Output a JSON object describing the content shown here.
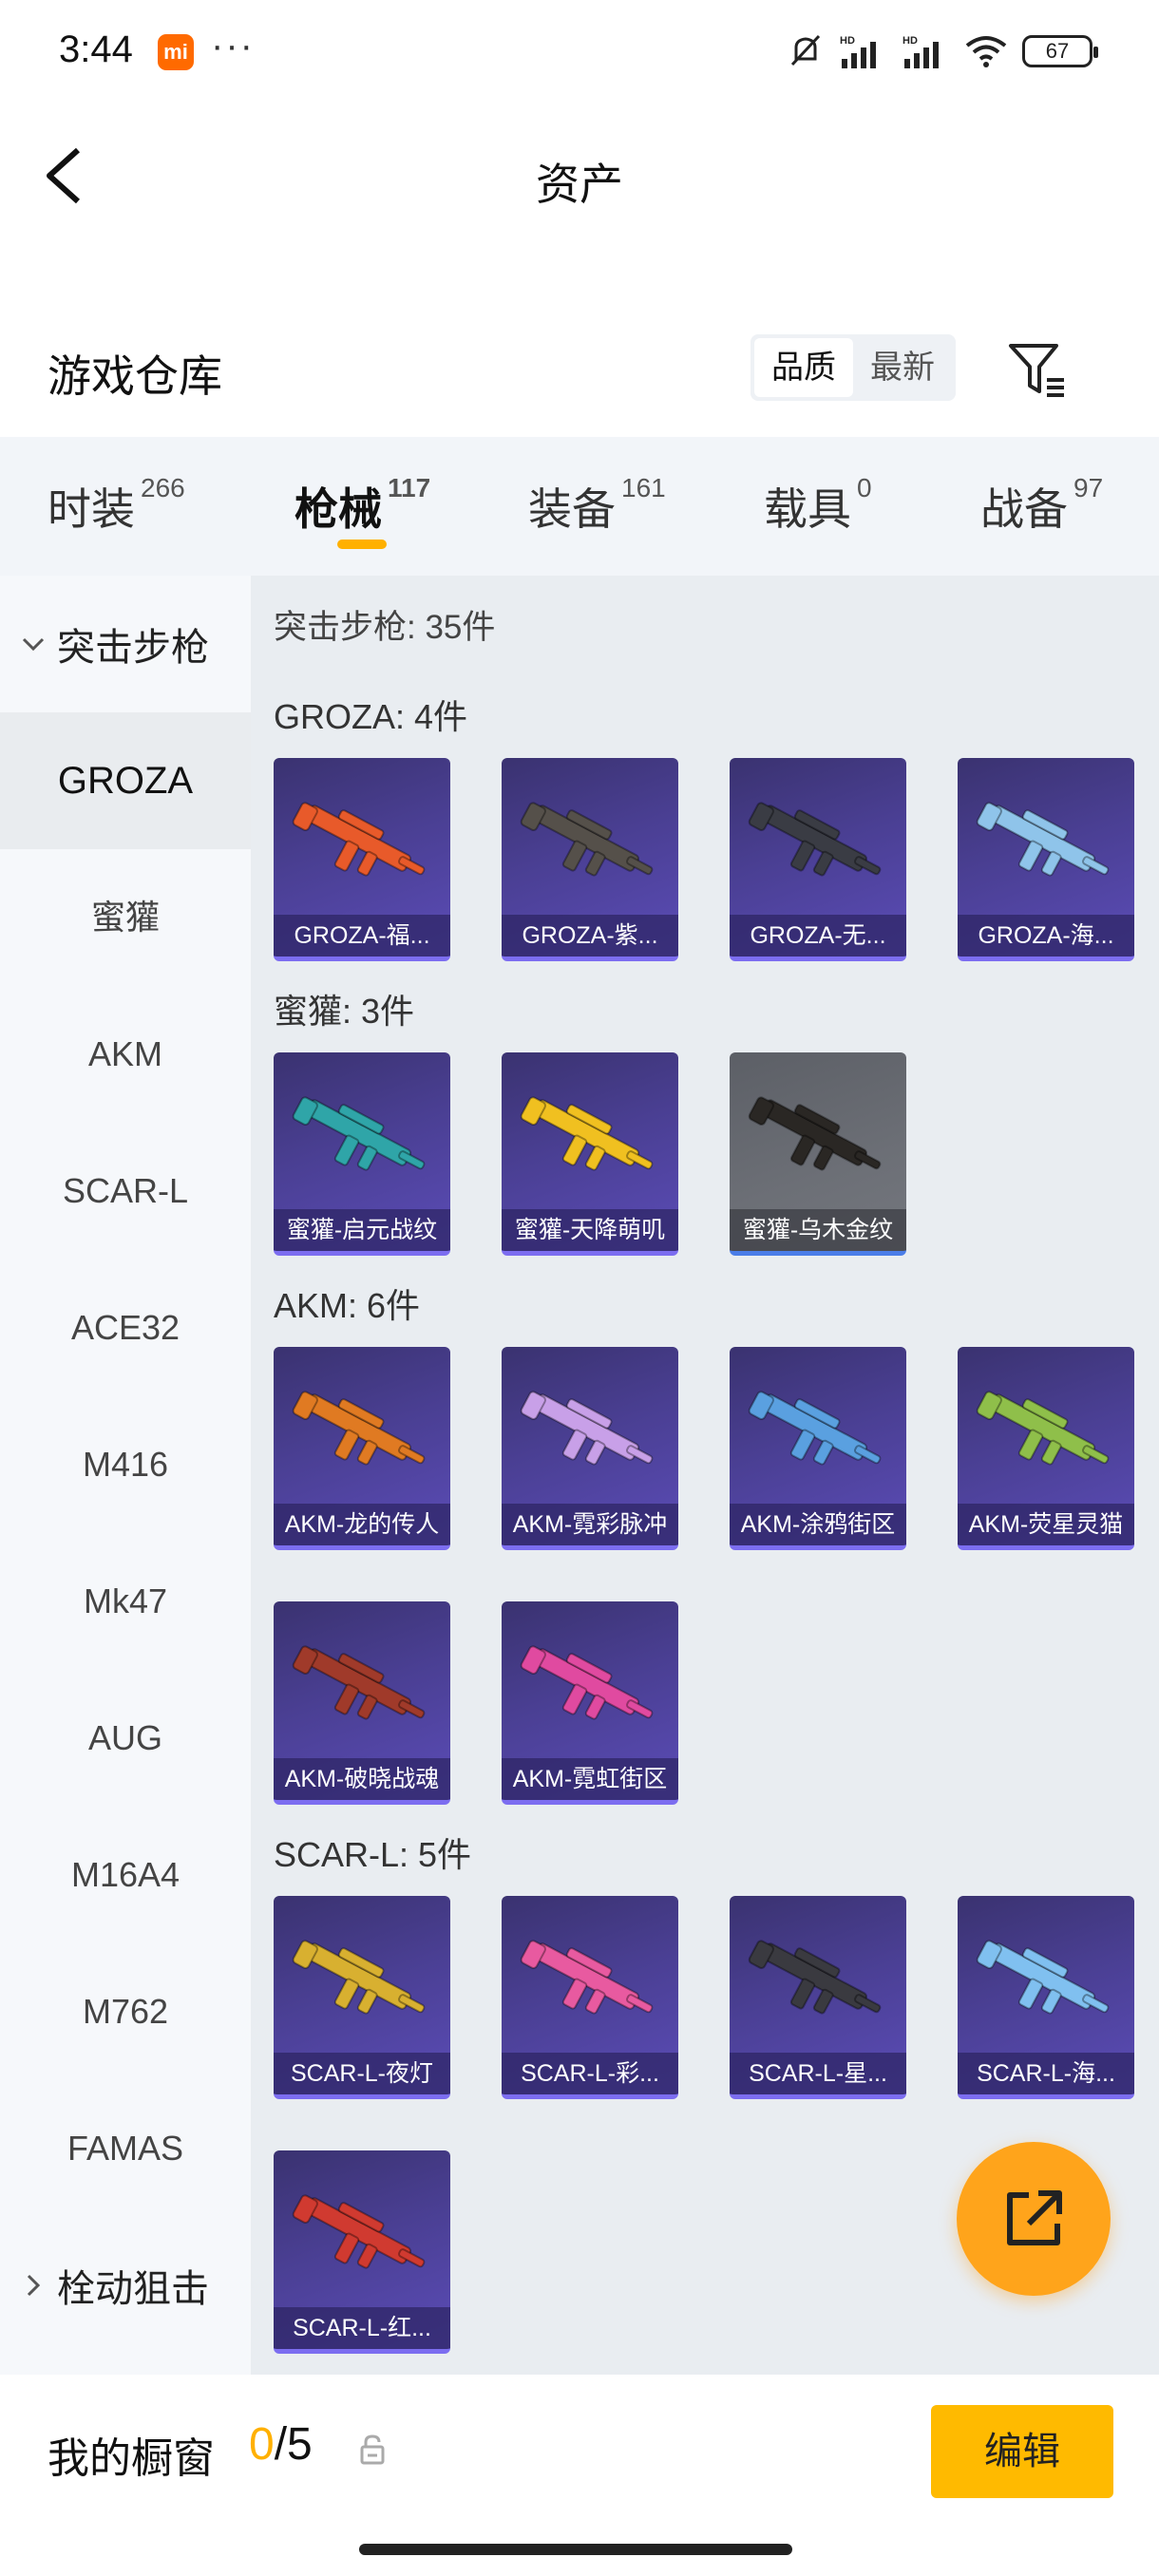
{
  "status_bar": {
    "time": "3:44",
    "mi": "mi",
    "dots": "···",
    "battery": "67"
  },
  "header": {
    "title": "资产"
  },
  "warehouse": {
    "title": "游戏仓库",
    "sort_quality": "品质",
    "sort_newest": "最新"
  },
  "tabs": [
    {
      "label": "时装",
      "count": "266"
    },
    {
      "label": "枪械",
      "count": "117"
    },
    {
      "label": "装备",
      "count": "161"
    },
    {
      "label": "载具",
      "count": "0"
    },
    {
      "label": "战备",
      "count": "97"
    }
  ],
  "sidebar": {
    "group_top": "突击步枪",
    "items": [
      "GROZA",
      "蜜獾",
      "AKM",
      "SCAR-L",
      "ACE32",
      "M416",
      "Mk47",
      "AUG",
      "M16A4",
      "M762",
      "FAMAS"
    ],
    "group_bottom": "栓动狙击"
  },
  "main": {
    "section_count": "突击步枪: 35件",
    "groups": [
      {
        "title": "GROZA: 4件",
        "items": [
          "GROZA-福...",
          "GROZA-紫...",
          "GROZA-无...",
          "GROZA-海..."
        ]
      },
      {
        "title": "蜜獾: 3件",
        "items": [
          "蜜獾-启元战纹",
          "蜜獾-天降萌叽",
          "蜜獾-乌木金纹"
        ]
      },
      {
        "title": "AKM: 6件",
        "items": [
          "AKM-龙的传人",
          "AKM-霓彩脉冲",
          "AKM-涂鸦街区",
          "AKM-荧星灵猫",
          "AKM-破晓战魂",
          "AKM-霓虹街区"
        ]
      },
      {
        "title": "SCAR-L: 5件",
        "items": [
          "SCAR-L-夜灯",
          "SCAR-L-彩...",
          "SCAR-L-星...",
          "SCAR-L-海...",
          "SCAR-L-红..."
        ]
      }
    ]
  },
  "bottom": {
    "label": "我的橱窗",
    "current": "0",
    "total": "/5",
    "edit": "编辑"
  },
  "colors": {
    "accent": "#ffb000",
    "card_purple": "#4a3f93",
    "fab": "#ffa41b"
  }
}
